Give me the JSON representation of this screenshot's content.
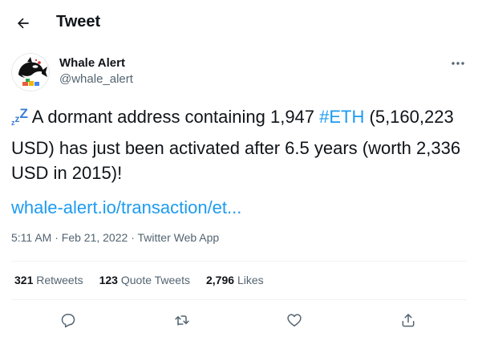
{
  "header": {
    "title": "Tweet",
    "back_icon": "back-arrow-icon"
  },
  "author": {
    "name": "Whale Alert",
    "handle": "@whale_alert"
  },
  "tweet": {
    "prefix_emoji": "zzz-icon",
    "text_before": " A dormant address containing 1,947 ",
    "hashtag": "#ETH",
    "text_after": " (5,160,223 USD) has just been activated after 6.5 years (worth 2,336 USD in 2015)!",
    "link": "whale-alert.io/transaction/et..."
  },
  "meta": {
    "time": "5:11 AM",
    "date": "Feb 21, 2022",
    "source": "Twitter Web App",
    "separator": "·"
  },
  "stats": {
    "retweets": {
      "count": "321",
      "label": "Retweets"
    },
    "quotes": {
      "count": "123",
      "label": "Quote Tweets"
    },
    "likes": {
      "count": "2,796",
      "label": "Likes"
    }
  },
  "actions": [
    "reply-icon",
    "retweet-icon",
    "like-icon",
    "share-icon"
  ],
  "colors": {
    "link": "#1d9bf0",
    "muted": "#536471",
    "text": "#0f1419",
    "divider": "#eff3f4"
  }
}
